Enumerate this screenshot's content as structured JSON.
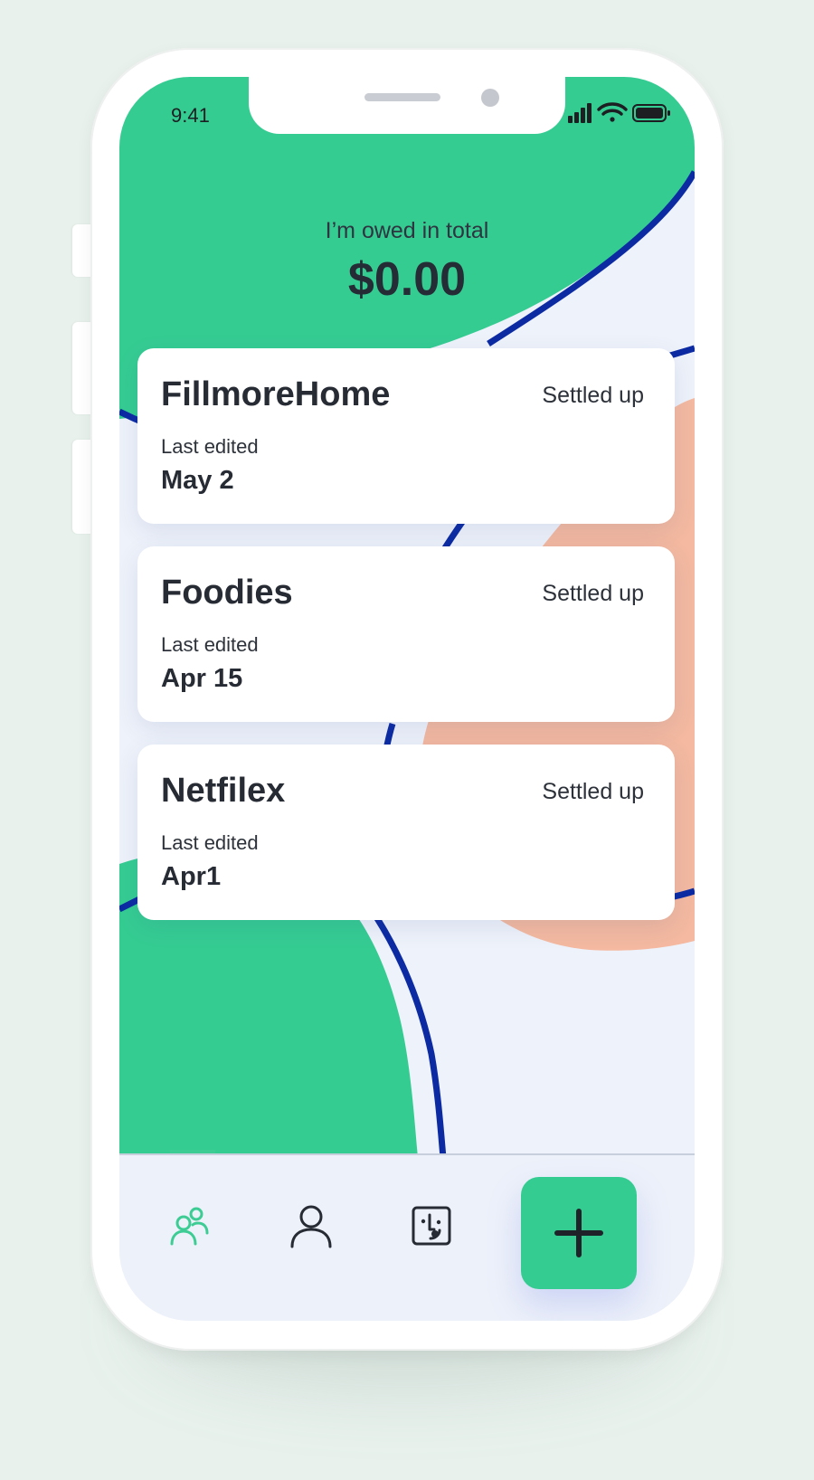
{
  "status_bar": {
    "time": "9:41",
    "icons": [
      "cellular-signal-icon",
      "wifi-icon",
      "battery-icon"
    ]
  },
  "header": {
    "label": "I’m owed in total",
    "amount": "$0.00"
  },
  "groups": [
    {
      "name": "FillmoreHome",
      "status": "Settled up",
      "edited_label": "Last edited",
      "edited_date": "May 2"
    },
    {
      "name": "Foodies",
      "status": "Settled up",
      "edited_label": "Last edited",
      "edited_date": "Apr 15"
    },
    {
      "name": "Netfilex",
      "status": "Settled up",
      "edited_label": "Last edited",
      "edited_date": "Apr1"
    }
  ],
  "tab_bar": {
    "tabs": [
      {
        "icon": "groups-icon",
        "active": true
      },
      {
        "icon": "person-icon",
        "active": false
      },
      {
        "icon": "activity-face-icon",
        "active": false
      }
    ],
    "fab_icon": "plus-icon"
  },
  "colors": {
    "accent": "#35CC92",
    "navy_line": "#0C2BA3",
    "peach": "#F4B9A0",
    "background": "#EEF2FA",
    "text": "#262B34"
  }
}
